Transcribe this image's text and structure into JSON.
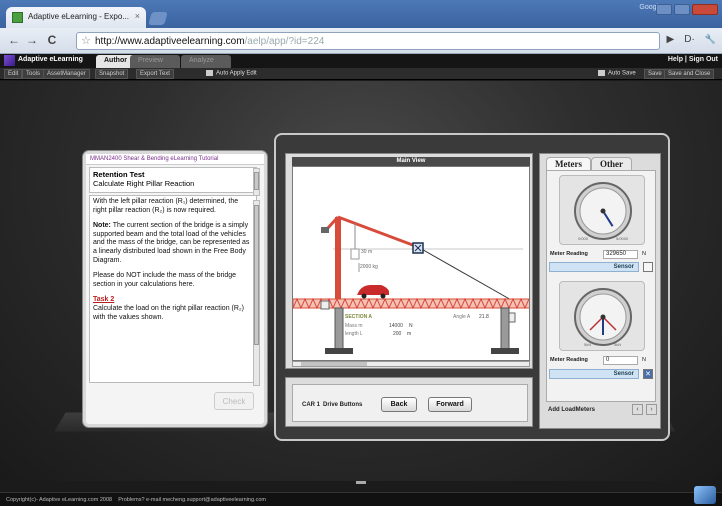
{
  "browser": {
    "tab_title": "Adaptive eLearning - Expo...",
    "tab_close": "×",
    "google_label": "Google",
    "url_host": "http://www.adaptiveelearning.com",
    "url_path": "/aelp/app/?id=224",
    "nav_back": "←",
    "nav_forward": "→",
    "nav_reload": "C",
    "star": "☆",
    "page_menu": "▶",
    "doc_menu": "D·",
    "wrench": "🔧"
  },
  "app": {
    "name": "Adaptive eLearning",
    "modes": [
      "Author",
      "Preview",
      "Analyze"
    ],
    "help_signout": "Help  |  Sign Out",
    "menu": [
      "Edit",
      "Tools",
      "AssetManager",
      "Snapshot",
      "Export Text"
    ],
    "auto_apply": "Auto Apply Edit",
    "auto_save": "Auto Save",
    "save": "Save",
    "save_close": "Save and Close"
  },
  "tutorial": {
    "title": "MMAN2400 Shear & Bending eLearning Tutorial",
    "heading": "Retention Test",
    "subheading": "Calculate Right Pillar Reaction",
    "p1": "With the left pillar reaction (R₁) determined, the right pillar reaction (R₂) is now required.",
    "note_label": "Note:",
    "note_text": " The current section of the bridge is a simply supported beam and the total load of the vehicles and the mass of the bridge, can be represented as a linearly distributed load shown in the Free Body Diagram.",
    "p3": "Please do NOT include the mass of the bridge section in your calculations here.",
    "task_label": "Task 2",
    "task_text": "Calculate the load on the right pillar reaction (R₂) with the values shown.",
    "check_button": "Check"
  },
  "main_view": {
    "title": "Main View",
    "crane_height": "30 m",
    "crane_load": "2000 kg",
    "section_label": "SECTION A",
    "mass_label": "Mass m",
    "mass_value": "14000",
    "mass_unit": "N",
    "length_label": "length L",
    "length_value": "200",
    "length_unit": "m",
    "angle_label": "Angle A",
    "angle_value": "21.8"
  },
  "controls": {
    "car_label": "CAR 1",
    "drive_label": "Drive Buttons",
    "back": "Back",
    "forward": "Forward"
  },
  "meters": {
    "tabs": [
      "Meters",
      "Other"
    ],
    "meter1": {
      "reading_label": "Meter Reading",
      "value": "329650",
      "unit": "N",
      "sensor_label": "Sensor",
      "sensor_on": false,
      "min_label": "0/000",
      "max_label": "5/0000",
      "level": 0.62
    },
    "meter2": {
      "reading_label": "Meter Reading",
      "value": "0",
      "unit": "N",
      "sensor_label": "Sensor",
      "sensor_on": true,
      "min_label": "5kN",
      "max_label": "5kN",
      "level": 0.5
    },
    "add_load_meters": "Add LoadMeters",
    "prev": "‹",
    "next": "›"
  },
  "footer": {
    "copyright": "Copyright(c)- Adaptive eLearning.com 2008",
    "support": "Problems? e-mail mecheng.support@adaptiveelearning.com",
    "handle": "▬"
  },
  "colors": {
    "accent_purple": "#7a2f8c",
    "task_red": "#b81d1d",
    "truss_red": "#d84b3a",
    "sensor_blue": "#cfe3f5"
  }
}
